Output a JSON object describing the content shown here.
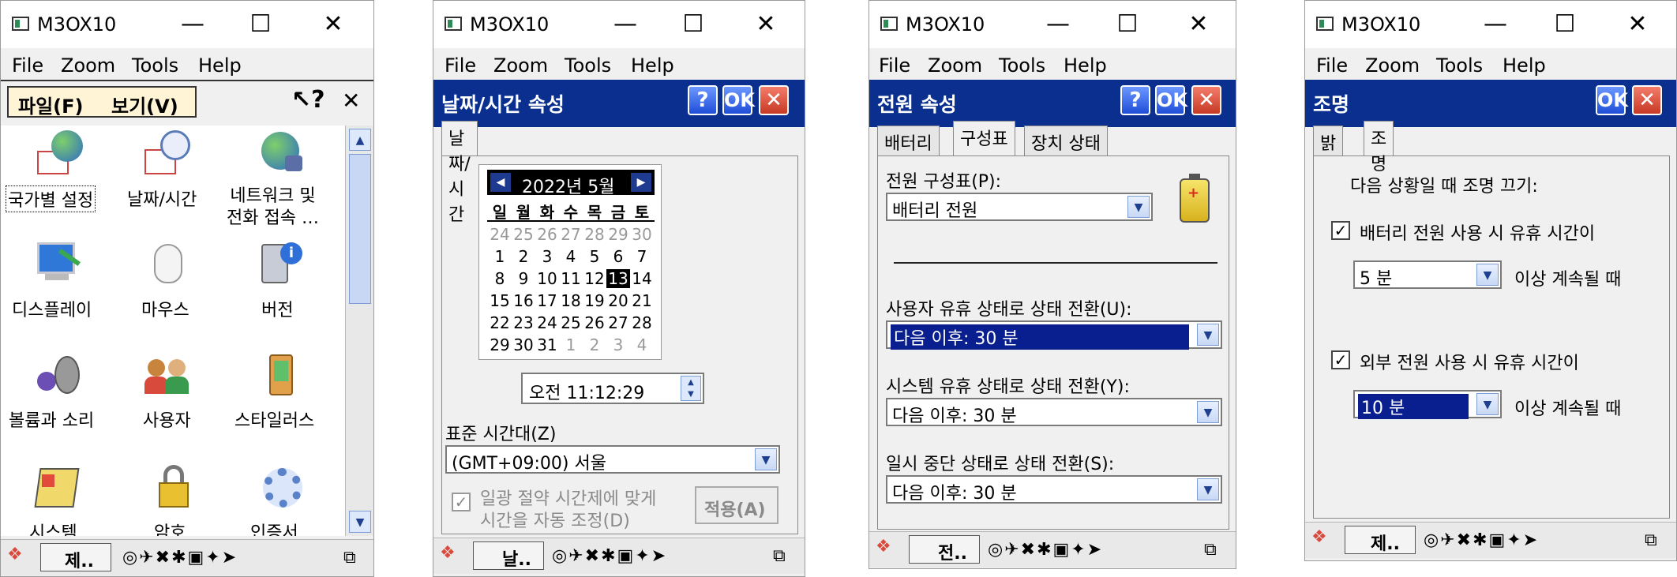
{
  "window_title": "M3OX10",
  "menu": {
    "file": "File",
    "zoom": "Zoom",
    "tools": "Tools",
    "help": "Help"
  },
  "panel1": {
    "menu_file": "파일(F)",
    "menu_view": "보기(V)",
    "icons": [
      {
        "label": "국가별 설정",
        "icon": "globe-calendar-icon"
      },
      {
        "label": "날짜/시간",
        "icon": "clock-calendar-icon"
      },
      {
        "label": "네트워크 및\n전화 접속 …",
        "icon": "network-globe-icon"
      },
      {
        "label": "디스플레이",
        "icon": "display-icon"
      },
      {
        "label": "마우스",
        "icon": "mouse-icon"
      },
      {
        "label": "버전",
        "icon": "info-device-icon"
      },
      {
        "label": "볼륨과 소리",
        "icon": "speaker-icon"
      },
      {
        "label": "사용자",
        "icon": "users-icon"
      },
      {
        "label": "스타일러스",
        "icon": "stylus-icon"
      },
      {
        "label": "시스템",
        "icon": "system-icon"
      },
      {
        "label": "암호",
        "icon": "lock-keys-icon"
      },
      {
        "label": "인증서",
        "icon": "gear-icon"
      }
    ],
    "task": "제.."
  },
  "panel2": {
    "title": "날짜/시간 속성",
    "tab": "날짜/시간",
    "month": "2022년 5월",
    "dow": [
      "일",
      "월",
      "화",
      "수",
      "목",
      "금",
      "토"
    ],
    "days": [
      [
        "24",
        "25",
        "26",
        "27",
        "28",
        "29",
        "30"
      ],
      [
        "1",
        "2",
        "3",
        "4",
        "5",
        "6",
        "7"
      ],
      [
        "8",
        "9",
        "10",
        "11",
        "12",
        "13",
        "14"
      ],
      [
        "15",
        "16",
        "17",
        "18",
        "19",
        "20",
        "21"
      ],
      [
        "22",
        "23",
        "24",
        "25",
        "26",
        "27",
        "28"
      ],
      [
        "29",
        "30",
        "31",
        "1",
        "2",
        "3",
        "4"
      ]
    ],
    "selected_day": "13",
    "time": "오전 11:12:29",
    "tz_label": "표준 시간대(Z)",
    "tz_value": "(GMT+09:00) 서울",
    "dst_label1": "일광 절약 시간제에 맞게",
    "dst_label2": "시간을 자동 조정(D)",
    "apply": "적용(A)",
    "task": "날.."
  },
  "panel3": {
    "title": "전원 속성",
    "tabs": [
      "배터리",
      "구성표",
      "장치 상태"
    ],
    "scheme_label": "전원 구성표(P):",
    "scheme_value": "배터리 전원",
    "user_idle_label": "사용자 유휴 상태로 상태 전환(U):",
    "user_idle_value": "다음 이후: 30 분",
    "sys_idle_label": "시스템 유휴 상태로 상태 전환(Y):",
    "sys_idle_value": "다음 이후: 30 분",
    "suspend_label": "일시 중단 상태로 상태 전환(S):",
    "suspend_value": "다음 이후: 30 분",
    "task": "전.."
  },
  "panel4": {
    "title": "조명",
    "tabs": [
      "밝기",
      "조명"
    ],
    "heading": "다음 상황일 때 조명 끄기:",
    "battery_check": "배터리 전원 사용 시 유휴 시간이",
    "battery_value": "5 분",
    "battery_suffix": "이상 계속될 때",
    "external_check": "외부 전원 사용 시 유휴 시간이",
    "external_value": "10 분",
    "external_suffix": "이상 계속될 때",
    "task": "제.."
  },
  "colors": {
    "dialog_header": "#0a2f8e",
    "selection": "#0a1f8f"
  }
}
